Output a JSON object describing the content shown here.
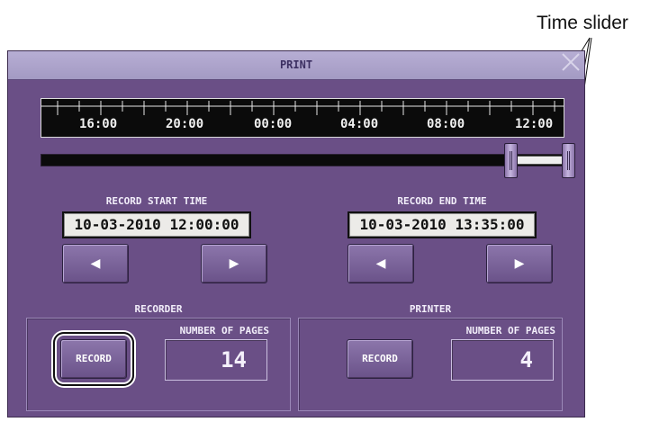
{
  "annotation": {
    "label": "Time slider"
  },
  "dialog": {
    "title": "PRINT",
    "timeline": {
      "tick_labels": [
        "16:00",
        "20:00",
        "00:00",
        "04:00",
        "08:00",
        "12:00"
      ]
    },
    "record_start": {
      "label": "RECORD START TIME",
      "value": "10-03-2010 12:00:00",
      "prev_symbol": "◀",
      "next_symbol": "▶"
    },
    "record_end": {
      "label": "RECORD END TIME",
      "value": "10-03-2010 13:35:00",
      "prev_symbol": "◀",
      "next_symbol": "▶"
    },
    "recorder": {
      "label": "RECORDER",
      "button_label": "RECORD",
      "pages_label": "NUMBER OF PAGES",
      "pages_value": "14"
    },
    "printer": {
      "label": "PRINTER",
      "button_label": "RECORD",
      "pages_label": "NUMBER OF PAGES",
      "pages_value": "4"
    }
  },
  "colors": {
    "panel": "#6a4f86",
    "titlebar": "#a39ac3",
    "timeline_bg": "#0b0b0b"
  }
}
